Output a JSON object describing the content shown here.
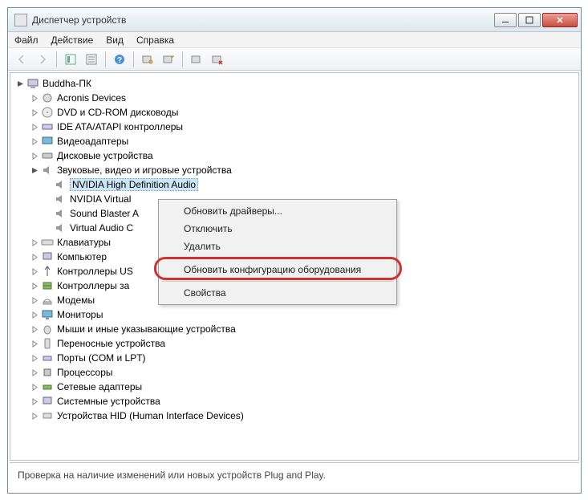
{
  "window": {
    "title": "Диспетчер устройств"
  },
  "menu": {
    "file": "Файл",
    "action": "Действие",
    "view": "Вид",
    "help": "Справка"
  },
  "tree": {
    "root": "Buddha-ПК",
    "nodes": {
      "acronis": "Acronis Devices",
      "dvd": "DVD и CD-ROM дисководы",
      "ide": "IDE ATA/ATAPI контроллеры",
      "video": "Видеоадаптеры",
      "disk": "Дисковые устройства",
      "sound": "Звуковые, видео и игровые устройства",
      "sound_children": {
        "nvidia_hd": "NVIDIA High Definition Audio",
        "nvidia_virtual": "NVIDIA Virtual",
        "sound_blaster": "Sound Blaster A",
        "virtual_audio": "Virtual Audio C"
      },
      "keyboard": "Клавиатуры",
      "computer": "Компьютер",
      "usb": "Контроллеры US",
      "storage": "Контроллеры за",
      "modems": "Модемы",
      "monitors": "Мониторы",
      "mice": "Мыши и иные указывающие устройства",
      "portable": "Переносные устройства",
      "ports": "Порты (COM и LPT)",
      "processors": "Процессоры",
      "network": "Сетевые адаптеры",
      "system": "Системные устройства",
      "hid": "Устройства HID (Human Interface Devices)"
    }
  },
  "context_menu": {
    "update_drivers": "Обновить драйверы...",
    "disable": "Отключить",
    "delete": "Удалить",
    "scan_hardware": "Обновить конфигурацию оборудования",
    "properties": "Свойства"
  },
  "statusbar": {
    "text": "Проверка на наличие изменений или новых устройств Plug and Play."
  }
}
